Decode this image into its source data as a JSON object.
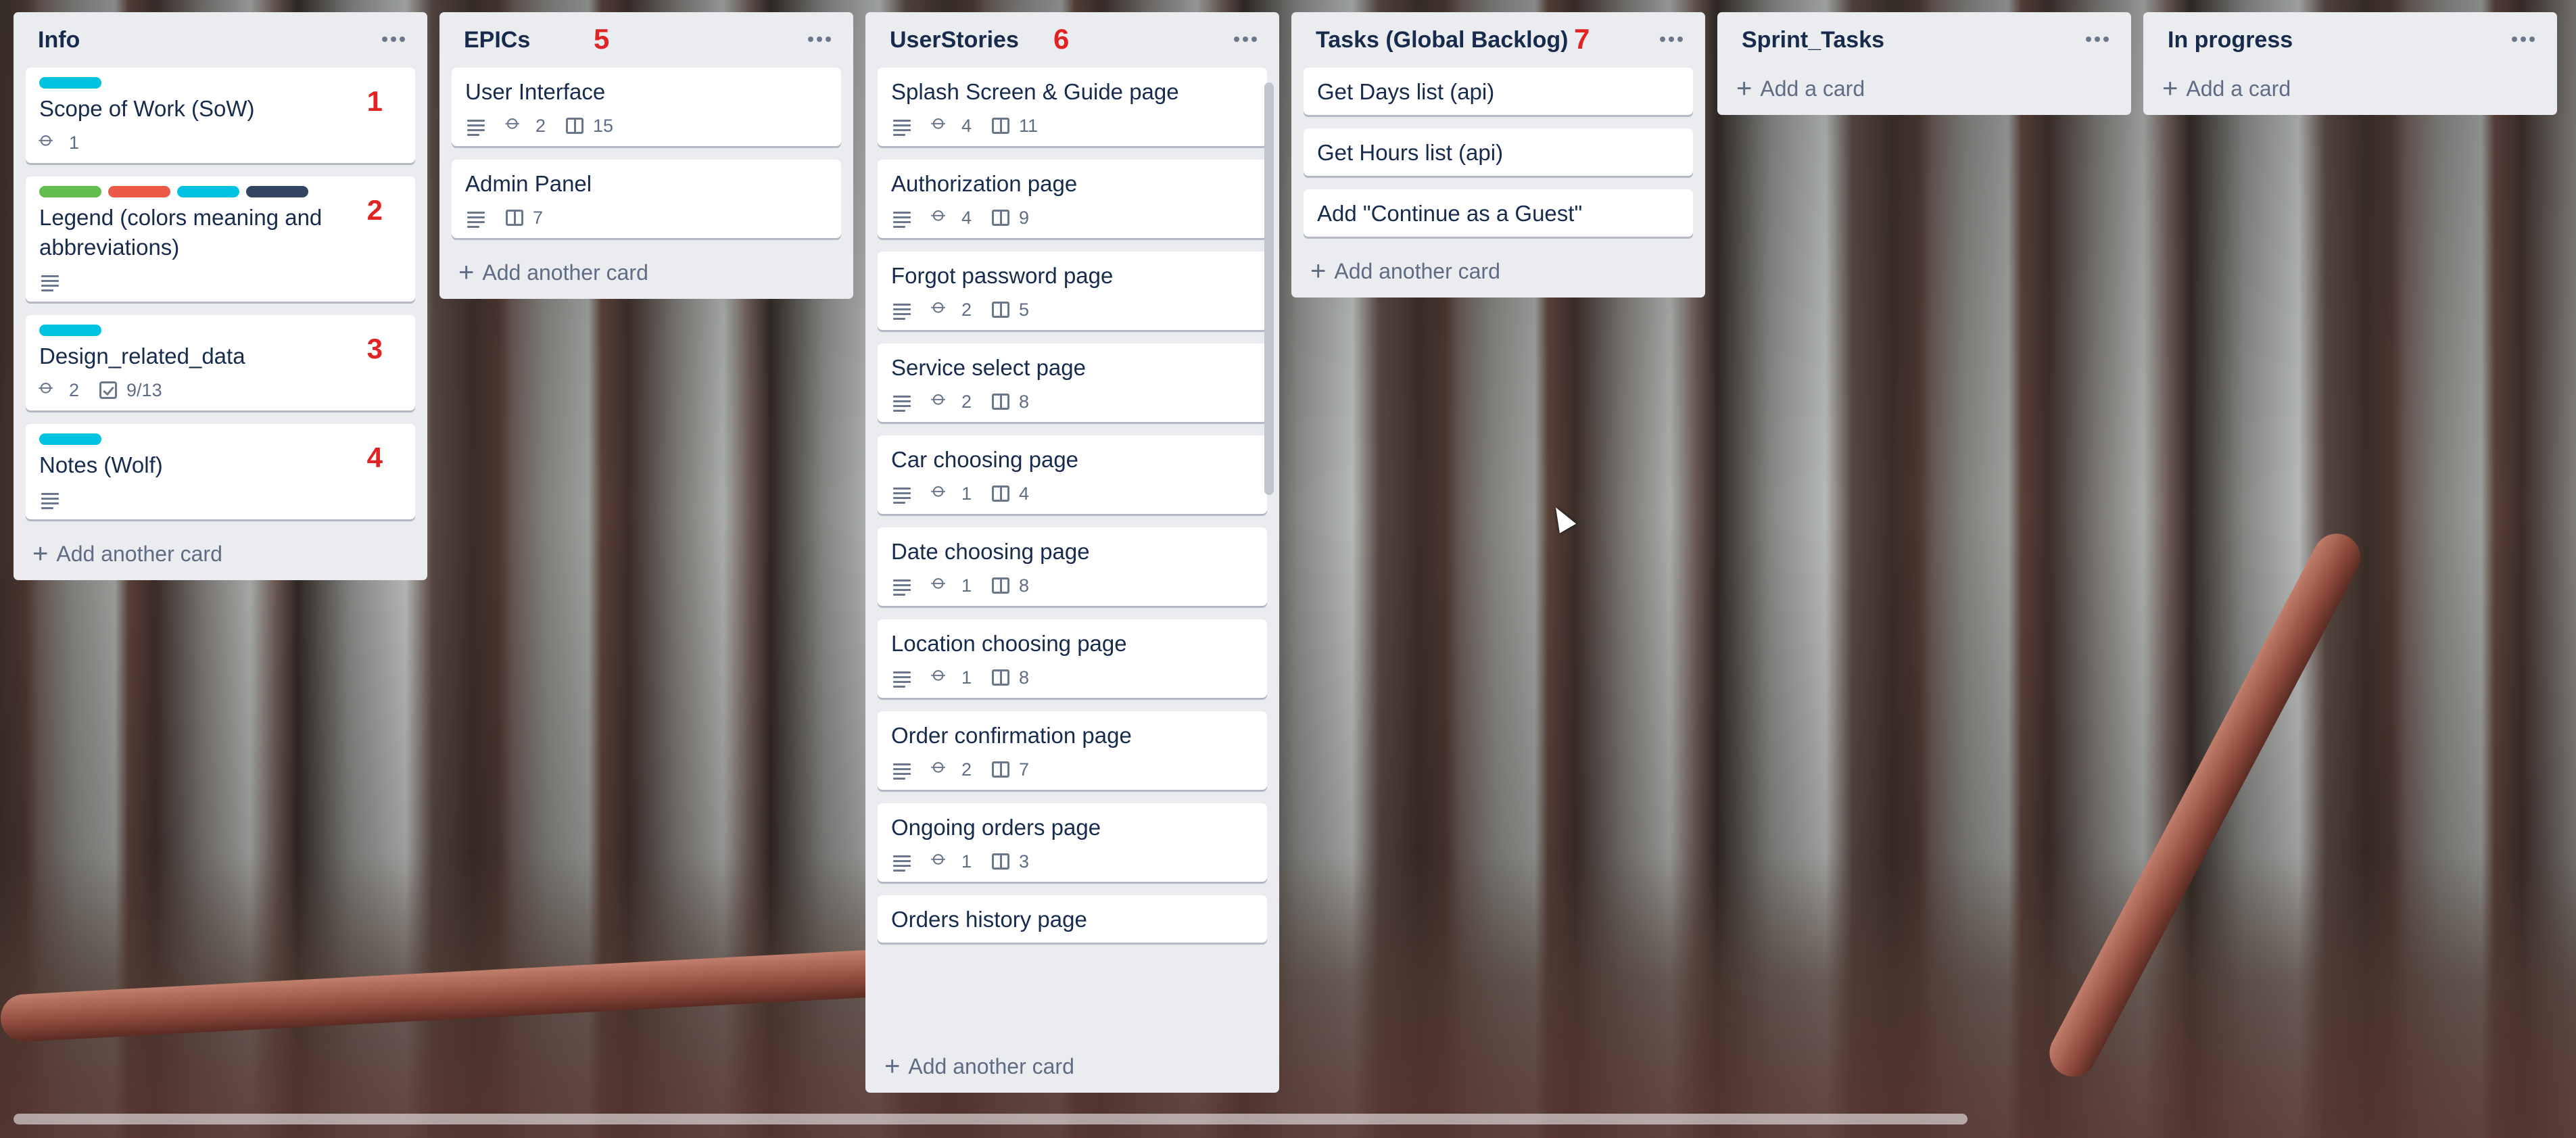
{
  "lists": [
    {
      "title": "Info",
      "number": "",
      "cards": [
        {
          "title": "Scope of Work (SoW)",
          "number": "1",
          "labels": [
            "#00c2e0"
          ],
          "attachments": "1"
        },
        {
          "title": "Legend (colors meaning and abbreviations)",
          "number": "2",
          "labels": [
            "#61bd4f",
            "#eb5a46",
            "#00c2e0",
            "#344563"
          ],
          "description": true
        },
        {
          "title": "Design_related_data",
          "number": "3",
          "labels": [
            "#00c2e0"
          ],
          "attachments": "2",
          "checklist": "9/13"
        },
        {
          "title": "Notes (Wolf)",
          "number": "4",
          "labels": [
            "#00c2e0"
          ],
          "description": true
        }
      ],
      "add_label": "Add another card"
    },
    {
      "title": "EPICs",
      "number": "5",
      "cards": [
        {
          "title": "User Interface",
          "description": true,
          "attachments": "2",
          "linked": "15"
        },
        {
          "title": "Admin Panel",
          "description": true,
          "linked": "7"
        }
      ],
      "add_label": "Add another card"
    },
    {
      "title": "UserStories",
      "number": "6",
      "cards": [
        {
          "title": "Splash Screen & Guide page",
          "description": true,
          "attachments": "4",
          "linked": "11"
        },
        {
          "title": "Authorization page",
          "description": true,
          "attachments": "4",
          "linked": "9"
        },
        {
          "title": "Forgot password page",
          "description": true,
          "attachments": "2",
          "linked": "5"
        },
        {
          "title": "Service select page",
          "description": true,
          "attachments": "2",
          "linked": "8"
        },
        {
          "title": "Car choosing page",
          "description": true,
          "attachments": "1",
          "linked": "4"
        },
        {
          "title": "Date choosing page",
          "description": true,
          "attachments": "1",
          "linked": "8"
        },
        {
          "title": "Location choosing page",
          "description": true,
          "attachments": "1",
          "linked": "8"
        },
        {
          "title": "Order confirmation page",
          "description": true,
          "attachments": "2",
          "linked": "7"
        },
        {
          "title": "Ongoing orders page",
          "description": true,
          "attachments": "1",
          "linked": "3"
        },
        {
          "title": "Orders history page"
        }
      ],
      "add_label": "Add another card"
    },
    {
      "title": "Tasks (Global Backlog)",
      "number": "7",
      "cards": [
        {
          "title": "Get Days list (api)"
        },
        {
          "title": "Get Hours list (api)"
        },
        {
          "title": "Add \"Continue as a Guest\""
        }
      ],
      "add_label": "Add another card"
    },
    {
      "title": "Sprint_Tasks",
      "number": "",
      "cards": [],
      "add_label": "Add a card"
    },
    {
      "title": "In progress",
      "number": "",
      "cards": [],
      "add_label": "Add a card"
    }
  ],
  "icons": {
    "list_menu": "ellipsis-icon",
    "description": "description-icon",
    "attachment": "paperclip-icon",
    "linked": "trello-board-icon",
    "checklist": "checklist-icon",
    "add": "plus-icon"
  },
  "colors": {
    "list_bg": "#ebecf0",
    "annotation_red": "#e02424"
  }
}
